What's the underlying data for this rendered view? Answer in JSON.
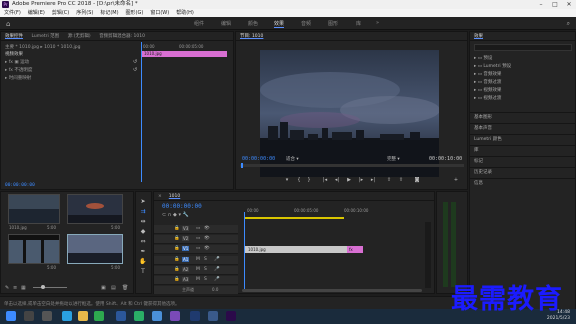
{
  "window": {
    "title": "Adobe Premiere Pro CC 2018 - [D:\\pr\\未命名] *"
  },
  "menu": [
    "文件(F)",
    "编辑(E)",
    "剪辑(C)",
    "序列(S)",
    "标记(M)",
    "图形(G)",
    "窗口(W)",
    "帮助(H)"
  ],
  "workspaces": [
    "组件",
    "编辑",
    "颜色",
    "效果",
    "音频",
    "图形",
    "库"
  ],
  "workspace_active": "效果",
  "effects_panel": {
    "tabs": [
      "效果控件",
      "Lumetri 范围",
      "源:(无剪辑)",
      "音频剪辑混合器: 1010"
    ],
    "clip_path": "主要 * 1010.jpg",
    "seq_path": "1010 * 1010.jpg",
    "section": "视频效果",
    "rows": [
      "运动",
      "不透明度",
      "时间重映射"
    ],
    "ruler_start": "00:00",
    "ruler_mid": "00:00:05:00",
    "clip_label": "1010.jpg",
    "timecode": "00:00:00:00"
  },
  "program": {
    "tab": "节目: 1010",
    "timecode_left": "00:00:00:00",
    "fit": "适合",
    "full": "完整",
    "timecode_right": "00:00:10:00"
  },
  "right_panel": {
    "title": "效果",
    "items": [
      "预设",
      "Lumetri 预设",
      "音频效果",
      "音频过渡",
      "视频效果",
      "视频过渡"
    ],
    "sections": [
      "基本图形",
      "基本声音",
      "Lumetri 颜色",
      "库",
      "标记",
      "历史记录",
      "信息"
    ]
  },
  "project": {
    "thumbs": [
      {
        "label": "1010.jpg",
        "dur": "5:00"
      },
      {
        "label": "",
        "dur": "5:00"
      },
      {
        "label": "",
        "dur": "5:00"
      },
      {
        "label": "",
        "dur": "5:00"
      }
    ]
  },
  "timeline": {
    "tab": "1010",
    "timecode": "00:00:00:00",
    "ruler": [
      "00:00",
      "00:00:05:00",
      "00:00:10:00"
    ],
    "video_tracks": [
      "V3",
      "V2",
      "V1"
    ],
    "audio_tracks": [
      "A1",
      "A2",
      "A3"
    ],
    "master": "主声道",
    "master_val": "0.0",
    "clip_v1": "1010.jpg",
    "clip_v1b": "fx"
  },
  "status": "单击以选择,或单击空白处并拖动以进行框选。使用 Shift、Alt 和 Ctrl 键获得其他选项。",
  "taskbar": {
    "time": "14:48",
    "date": "2021/5/23"
  },
  "watermark": "最需教育",
  "colors": {
    "accent": "#3d8bff",
    "clip": "#d86fd2",
    "gray_clip": "#c8c8c8",
    "playhead": "#3d8bff"
  }
}
